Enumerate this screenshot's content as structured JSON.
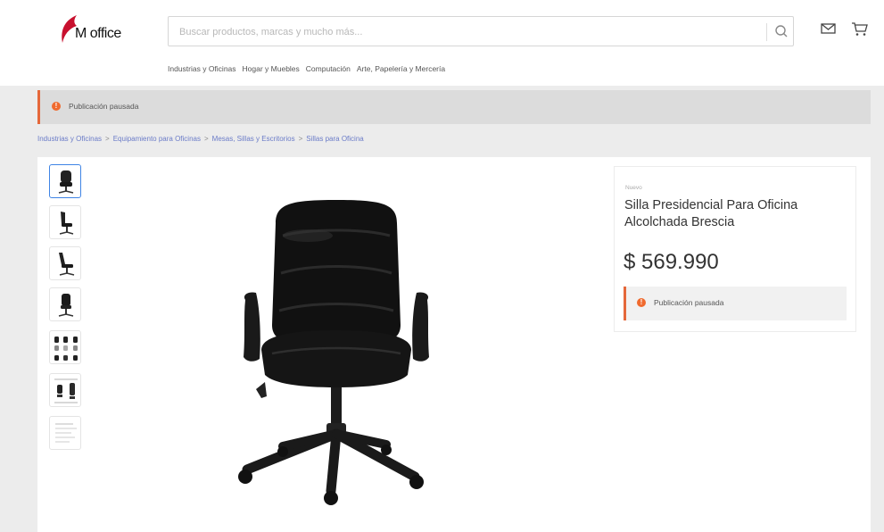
{
  "header": {
    "logo_text": "M office",
    "search_placeholder": "Buscar productos, marcas y mucho más...",
    "icons": [
      "search-icon",
      "mail-icon",
      "cart-icon"
    ],
    "nav": [
      "Industrias y Oficinas",
      "Hogar y Muebles",
      "Computación",
      "Arte, Papelería y Mercería"
    ]
  },
  "notice": {
    "icon": "warning-icon",
    "text": "Publicación pausada"
  },
  "breadcrumb": [
    "Industrias y Oficinas",
    "Equipamiento para Oficinas",
    "Mesas, Sillas y Escritorios",
    "Sillas para Oficina"
  ],
  "gallery": {
    "thumbnails": [
      "chair-front",
      "chair-side",
      "chair-reclined",
      "chair-back",
      "chair-set",
      "chair-dimensions",
      "spec-sheet"
    ],
    "selected_index": 0
  },
  "product": {
    "condition": "Nuevo",
    "title": "Silla Presidencial Para Oficina Alcolchada Brescia",
    "price": "$ 569.990",
    "status": "Publicación pausada"
  },
  "colors": {
    "accent": "#e5683a",
    "brand": "#c8102e",
    "link": "#6b7cc8",
    "thumb_selected": "#3f84e5"
  }
}
